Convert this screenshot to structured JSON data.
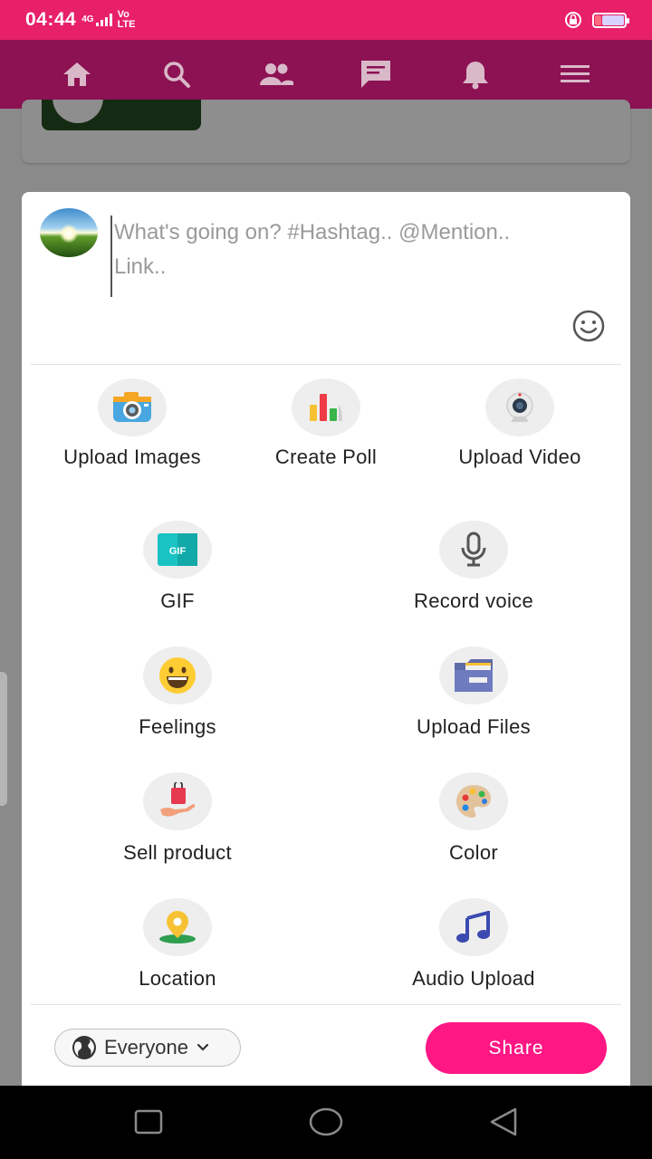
{
  "status_bar": {
    "time": "04:44",
    "network_top": "4G",
    "network_bottom": "Vo LTE"
  },
  "nav": {
    "items": [
      "home-icon",
      "search-icon",
      "people-icon",
      "chat-icon",
      "bell-icon",
      "menu-icon"
    ]
  },
  "composer": {
    "placeholder": "What's going on? #Hashtag.. @Mention.. Link..",
    "options": {
      "upload_images": "Upload Images",
      "create_poll": "Create Poll",
      "upload_video": "Upload Video",
      "gif": "GIF",
      "gif_badge": "GIF",
      "record_voice": "Record voice",
      "feelings": "Feelings",
      "upload_files": "Upload Files",
      "sell_product": "Sell product",
      "color": "Color",
      "location": "Location",
      "audio_upload": "Audio Upload"
    },
    "audience": "Everyone",
    "share_label": "Share"
  },
  "colors": {
    "status_bar": "#e8206a",
    "nav_bar": "#8c1253",
    "share_button": "#ff1784"
  }
}
